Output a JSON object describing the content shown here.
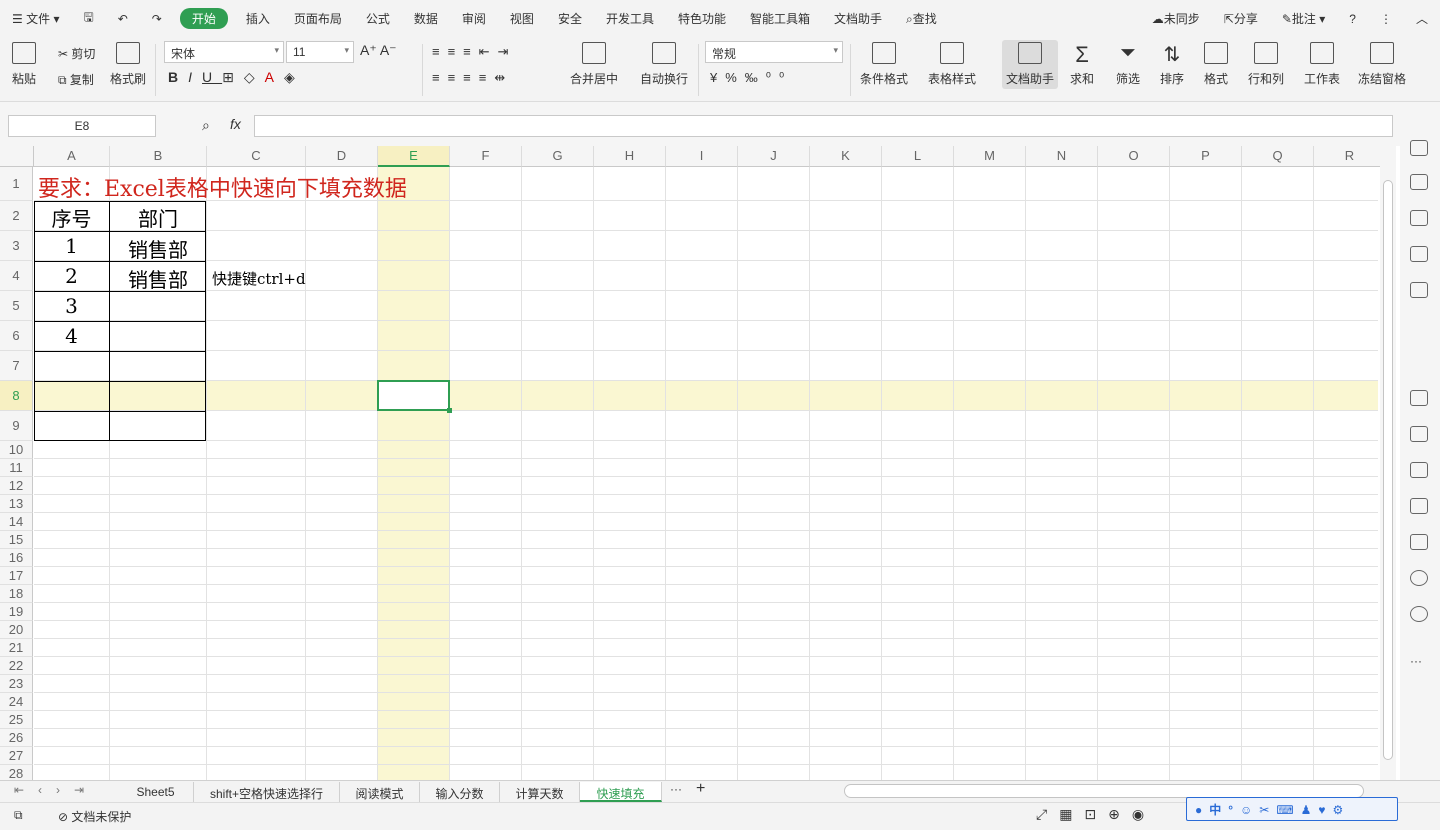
{
  "menu": {
    "app_menu": "文件",
    "tabs": [
      "开始",
      "插入",
      "页面布局",
      "公式",
      "数据",
      "审阅",
      "视图",
      "安全",
      "开发工具",
      "特色功能",
      "智能工具箱",
      "文档助手"
    ],
    "search": "查找",
    "sync": "未同步",
    "share": "分享",
    "annotate": "批注"
  },
  "ribbon": {
    "paste": "粘贴",
    "cut": "剪切",
    "copy": "复制",
    "format_painter": "格式刷",
    "font_name": "宋体",
    "font_size": "11",
    "merge_center": "合并居中",
    "wrap_text": "自动换行",
    "number_format": "常规",
    "conditional_format": "条件格式",
    "table_style": "表格样式",
    "doc_assistant": "文档助手",
    "sum": "求和",
    "filter": "筛选",
    "sort": "排序",
    "format": "格式",
    "rows_cols": "行和列",
    "worksheet": "工作表",
    "freeze": "冻结窗格"
  },
  "formula_bar": {
    "name_box": "E8",
    "fx": "fx",
    "formula": ""
  },
  "columns": [
    "A",
    "B",
    "C",
    "D",
    "E",
    "F",
    "G",
    "H",
    "I",
    "J",
    "K",
    "L",
    "M",
    "N",
    "O",
    "P",
    "Q",
    "R"
  ],
  "rows": [
    "1",
    "2",
    "3",
    "4",
    "5",
    "6",
    "7",
    "8",
    "9",
    "10",
    "11",
    "12",
    "13",
    "14",
    "15",
    "16",
    "17",
    "18",
    "19",
    "20",
    "21",
    "22",
    "23",
    "24",
    "25",
    "26",
    "27",
    "28"
  ],
  "cells": {
    "A1": "要求：Excel表格中快速向下填充数据",
    "A2": "序号",
    "B2": "部门",
    "A3": "1",
    "B3": "销售部",
    "A4": "2",
    "B4": "销售部",
    "C4": "快捷键ctrl+d",
    "A5": "3",
    "A6": "4"
  },
  "sheet_tabs": [
    "Sheet5",
    "shift+空格快速选择行",
    "阅读模式",
    "输入分数",
    "计算天数",
    "快速填充"
  ],
  "active_sheet": "快速填充",
  "status": {
    "protection": "文档未保护"
  },
  "colors": {
    "accent": "#2f9e52",
    "title_red": "#d0261d",
    "highlight": "#faf7d2"
  }
}
